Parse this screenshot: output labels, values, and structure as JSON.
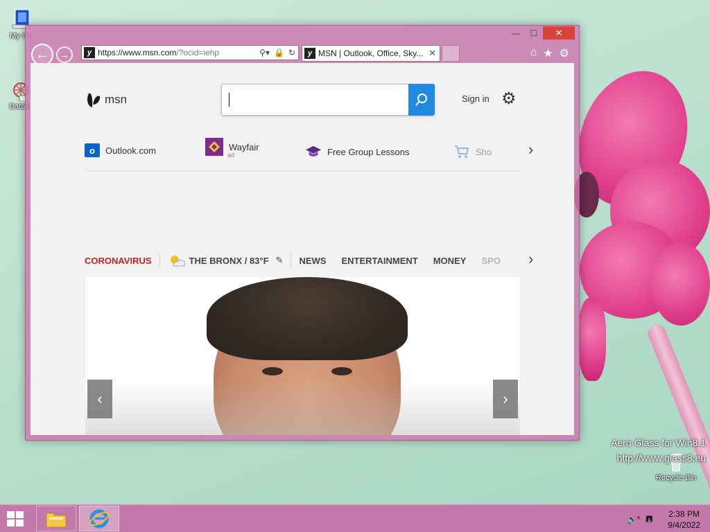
{
  "desktop": {
    "icons": [
      {
        "label": "My Co",
        "icon": "computer-icon"
      },
      {
        "label": "DataW",
        "icon": "datawatch-icon"
      },
      {
        "label": "Recycle Bin",
        "icon": "recycle-bin-icon"
      }
    ],
    "watermark": {
      "line1": "Aero Glass for Win8.1",
      "line2": "http://www.glass8.eu"
    }
  },
  "browser": {
    "address": {
      "prefix": "https://www.",
      "host": "msn.com",
      "path": "/?ocid=iehp"
    },
    "tab": {
      "title": "MSN | Outlook, Office, Sky..."
    },
    "caption": {
      "minimize": "—",
      "maximize": "☐",
      "close": "✕"
    }
  },
  "msn": {
    "logo_text": "msn",
    "search": {
      "value": "",
      "placeholder": ""
    },
    "signin": "Sign in",
    "quick_links": [
      {
        "label": "Outlook.com",
        "icon": "outlook-icon"
      },
      {
        "label": "Wayfair",
        "sub": "ad",
        "icon": "wayfair-icon"
      },
      {
        "label": "Free Group Lessons",
        "icon": "graduation-cap-icon"
      },
      {
        "label": "Sho",
        "icon": "shopping-cart-icon"
      }
    ],
    "categories": {
      "corona": "CORONAVIRUS",
      "weather": "THE BRONX / 83°F",
      "items": [
        "NEWS",
        "ENTERTAINMENT",
        "MONEY",
        "SPO"
      ]
    }
  },
  "taskbar": {
    "time": "2:38 PM",
    "date": "9/4/2022"
  },
  "colors": {
    "accent": "#1f8ae0",
    "corona": "#c0261f",
    "taskbar": "#c46ea6",
    "close": "#d9423a"
  }
}
